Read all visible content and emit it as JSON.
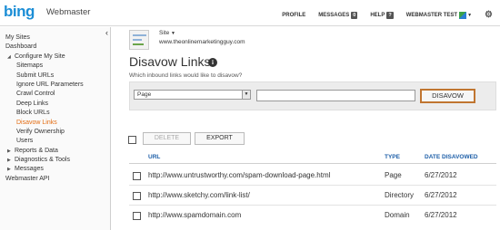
{
  "brand": {
    "logo": "bing",
    "product": "Webmaster"
  },
  "topnav": {
    "profile": "PROFILE",
    "messages": "MESSAGES",
    "messages_count": "0",
    "help": "HELP",
    "help_badge": "?",
    "account": "WEBMASTER TEST"
  },
  "sidebar": {
    "items": [
      {
        "label": "My Sites"
      },
      {
        "label": "Dashboard"
      },
      {
        "label": "Configure My Site"
      },
      {
        "label": "Sitemaps"
      },
      {
        "label": "Submit URLs"
      },
      {
        "label": "Ignore URL Parameters"
      },
      {
        "label": "Crawl Control"
      },
      {
        "label": "Deep Links"
      },
      {
        "label": "Block URLs"
      },
      {
        "label": "Disavow Links"
      },
      {
        "label": "Verify Ownership"
      },
      {
        "label": "Users"
      },
      {
        "label": "Reports & Data"
      },
      {
        "label": "Diagnostics & Tools"
      },
      {
        "label": "Messages"
      },
      {
        "label": "Webmaster API"
      }
    ]
  },
  "site": {
    "label": "Site",
    "url": "www.theonlinemarketingguy.com"
  },
  "page": {
    "title": "Disavow Links",
    "question": "Which inbound links would like to disavow?"
  },
  "form": {
    "type_value": "Page",
    "url_value": "",
    "disavow_label": "DISAVOW"
  },
  "toolbar": {
    "delete_label": "DELETE",
    "export_label": "EXPORT"
  },
  "table": {
    "headers": {
      "url": "URL",
      "type": "TYPE",
      "date": "DATE DISAVOWED"
    },
    "rows": [
      {
        "url": "http://www.untrustworthy.com/spam-download-page.html",
        "type": "Page",
        "date": "6/27/2012"
      },
      {
        "url": "http://www.sketchy.com/link-list/",
        "type": "Directory",
        "date": "6/27/2012"
      },
      {
        "url": "http://www.spamdomain.com",
        "type": "Domain",
        "date": "6/27/2012"
      }
    ]
  },
  "colors": {
    "accent": "#1c8ed6",
    "active_nav": "#e36c12",
    "link_header": "#1e5fa8",
    "disavow_border": "#c07530"
  }
}
